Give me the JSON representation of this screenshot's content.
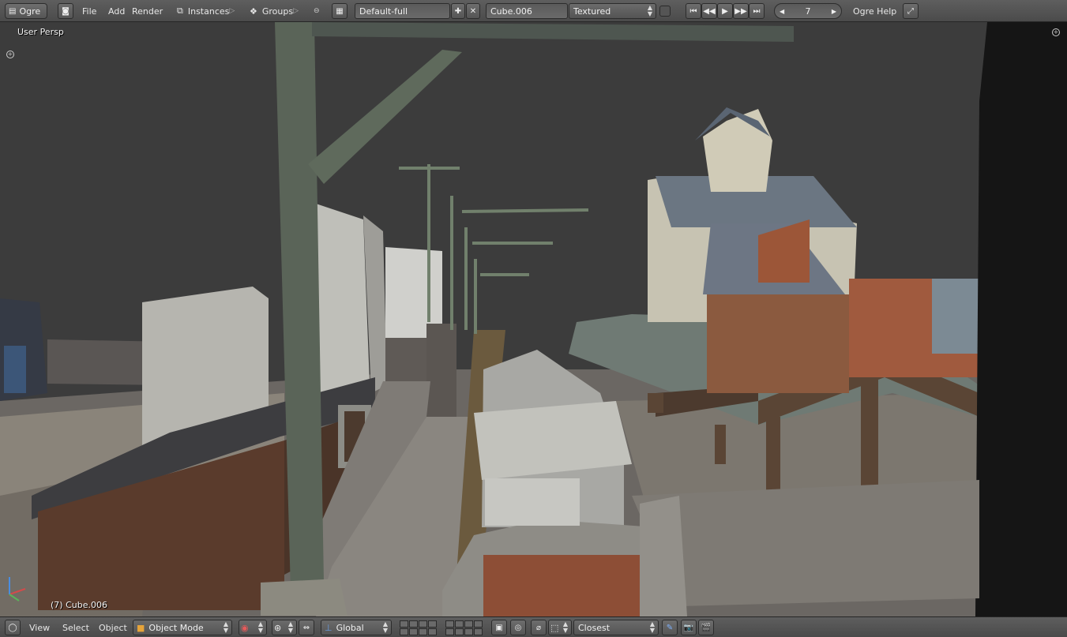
{
  "top_header": {
    "engine_select": "Ogre",
    "menus": [
      "File",
      "Add",
      "Render"
    ],
    "instances_label": "Instances",
    "groups_label": "Groups",
    "screen_layout": "Default-full",
    "scene_object": "Cube.006",
    "render_engine": "Textured",
    "frame": "7",
    "help_label": "Ogre Help"
  },
  "viewport": {
    "view_name": "User Persp",
    "selected_object_label": "(7) Cube.006"
  },
  "bottom_header": {
    "menus": [
      "View",
      "Select",
      "Object"
    ],
    "mode": "Object Mode",
    "orientation": "Global",
    "snap_target": "Closest"
  },
  "colors": {
    "header_bg": "#4f4f4f",
    "sky": "#3c3c3c",
    "steel": "#5a6458",
    "roof": "#6f7a74",
    "wood": "#4c3a2e"
  },
  "icons": {
    "editor_type": "monitor-icon",
    "play_controls": [
      "jump-start-icon",
      "rewind-icon",
      "play-icon",
      "fast-forward-icon",
      "jump-end-icon"
    ],
    "fullscreen": "fullscreen-icon"
  }
}
